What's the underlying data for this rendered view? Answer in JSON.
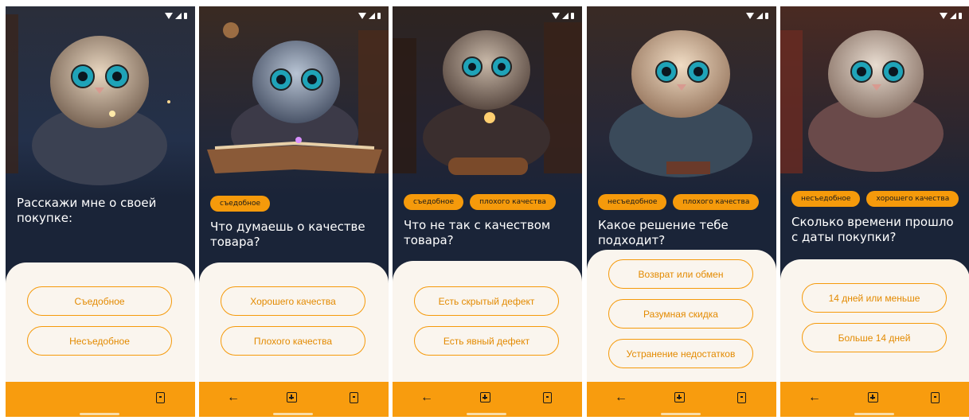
{
  "colors": {
    "accent": "#f89c0e",
    "panel": "#faf5ee",
    "background": "#1a2438"
  },
  "screens": [
    {
      "tags": [],
      "question": "Расскажи мне о своей покупке:",
      "options": [
        "Съедобное",
        "Несъедобное"
      ],
      "nav": {
        "back": false,
        "home": false,
        "recent": true
      }
    },
    {
      "tags": [
        "съедобное"
      ],
      "question": "Что думаешь о качестве товара?",
      "options": [
        "Хорошего качества",
        "Плохого качества"
      ],
      "nav": {
        "back": true,
        "home": true,
        "recent": true
      }
    },
    {
      "tags": [
        "съедобное",
        "плохого качества"
      ],
      "question": "Что не так с качеством товара?",
      "options": [
        "Есть скрытый дефект",
        "Есть явный дефект"
      ],
      "nav": {
        "back": true,
        "home": true,
        "recent": true
      }
    },
    {
      "tags": [
        "несъедобное",
        "плохого качества"
      ],
      "question": "Какое решение тебе подходит?",
      "options": [
        "Возврат или обмен",
        "Разумная скидка",
        "Устранение недостатков"
      ],
      "nav": {
        "back": true,
        "home": true,
        "recent": true
      }
    },
    {
      "tags": [
        "несъедобное",
        "хорошего качества"
      ],
      "question": "Сколько времени прошло с даты покупки?",
      "options": [
        "14 дней или меньше",
        "Больше 14 дней"
      ],
      "nav": {
        "back": true,
        "home": true,
        "recent": true
      }
    }
  ],
  "icons": {
    "back": "arrow-left-icon",
    "home": "home-grid-icon",
    "recent": "recent-apps-icon"
  }
}
